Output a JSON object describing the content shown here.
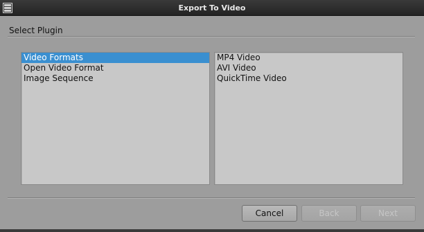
{
  "window": {
    "title": "Export To Video",
    "icon": "film-strip-icon"
  },
  "section_label": "Select Plugin",
  "plugin_categories": [
    {
      "label": "Video Formats",
      "selected": true
    },
    {
      "label": "Open Video Format",
      "selected": false
    },
    {
      "label": "Image Sequence",
      "selected": false
    }
  ],
  "plugin_formats": [
    {
      "label": "MP4 Video"
    },
    {
      "label": "AVI Video"
    },
    {
      "label": "QuickTime Video"
    }
  ],
  "buttons": {
    "cancel": "Cancel",
    "back": "Back",
    "next": "Next"
  },
  "colors": {
    "selection": "#3a8fd0",
    "titlebar": "#2e2e2e",
    "background": "#9d9d9d"
  }
}
